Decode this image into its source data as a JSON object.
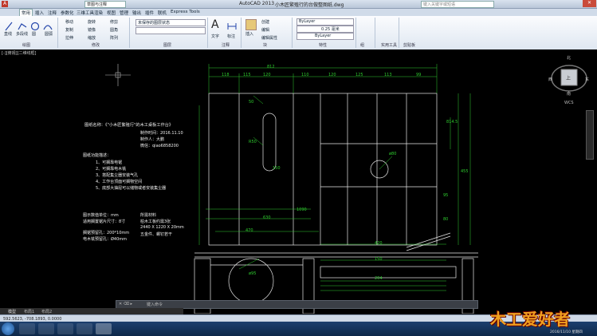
{
  "window": {
    "app_title": "AutoCAD 2013",
    "file_title": "小木匠繁殖行的台做整图纸.dwg",
    "search_placeholder": "键入关键字或短语",
    "workspace": "草图与注释"
  },
  "tabs": [
    "常用",
    "插入",
    "注释",
    "参数化",
    "三维工具",
    "渲染",
    "视图",
    "管理",
    "输出",
    "插件",
    "联机",
    "Express Tools"
  ],
  "ribbon": {
    "draw_tools": [
      "直线",
      "多段线",
      "圆",
      "圆弧"
    ],
    "modify_tools": [
      "移动",
      "旋转",
      "修剪",
      "复制",
      "镜像",
      "圆角",
      "拉伸",
      "缩放",
      "阵列"
    ],
    "layer_label": "未保存的图层状态",
    "annotate": [
      "文字",
      "标注"
    ],
    "block": [
      "插入",
      "创建",
      "编辑",
      "编辑属性"
    ],
    "props": [
      "ByLayer",
      "ByLayer",
      "ByLayer"
    ],
    "lineweight": "0.25 毫米",
    "group_labels": [
      "绘图",
      "修改",
      "图层",
      "注释",
      "块",
      "特性",
      "组",
      "实用工具",
      "剪贴板"
    ]
  },
  "file_tab": "[-][俯视][二维线框]",
  "viewcube": {
    "top": "北",
    "left": "西",
    "right": "东",
    "bottom": "南",
    "center": "上",
    "wcs": "WCS"
  },
  "drawing_text": {
    "title": "图纸名称：《\"小木匠繁殖行\"的木工桌板工作台》",
    "date": "制作时间：2016.11.10",
    "author": "制作人：大鹏",
    "wechat": "微信：qiao6858200",
    "features_title": "图纸功能描述：",
    "features": [
      "1、可搁靠电锯",
      "2、可搁靠电木铣",
      "3、搭配集尘器安装气孔",
      "4、工作台顶面可搁物空间",
      "5、底部大抽屉可以储物或者安装集尘器"
    ],
    "unit": "图示数值单位：mm",
    "board_size": "适用搁置锯片尺寸：8寸",
    "saw_size": "搁锯预留孔：200*10mm",
    "motor_hole": "电木铣预留孔：Ø40mm",
    "materials_title": "所需材料",
    "mat1": "柏木工板约需3张",
    "mat2": "2440 X 1220 X 20mm",
    "mat3": "五金件、螺钉若干"
  },
  "dims": {
    "d1": "812",
    "d2": "118",
    "d3": "120",
    "d4": "115",
    "d5": "110",
    "d6": "120",
    "d7": "125",
    "d8": "113",
    "d9": "99",
    "d10": "370",
    "d11": "210",
    "d12": "50",
    "d13": "R50",
    "d14": "ø80",
    "d15": "150",
    "d16": "1090",
    "d17": "630",
    "d18": "470",
    "d19": "420",
    "d20": "150",
    "d21": "204",
    "d22": "400",
    "d23": "814.5",
    "d24": "455",
    "d25": "95",
    "d26": "80",
    "d27": "250",
    "d28": "304",
    "d29": "110",
    "d30": "ø95",
    "d31": "30",
    "d32": "120"
  },
  "command": "键入命令",
  "model_tabs": [
    "模型",
    "布局1",
    "布局2"
  ],
  "status_coords": "592.5623, -708.1893, 0.0000",
  "clock": "2016/11/10 星期四",
  "watermark": "木工爱好者"
}
